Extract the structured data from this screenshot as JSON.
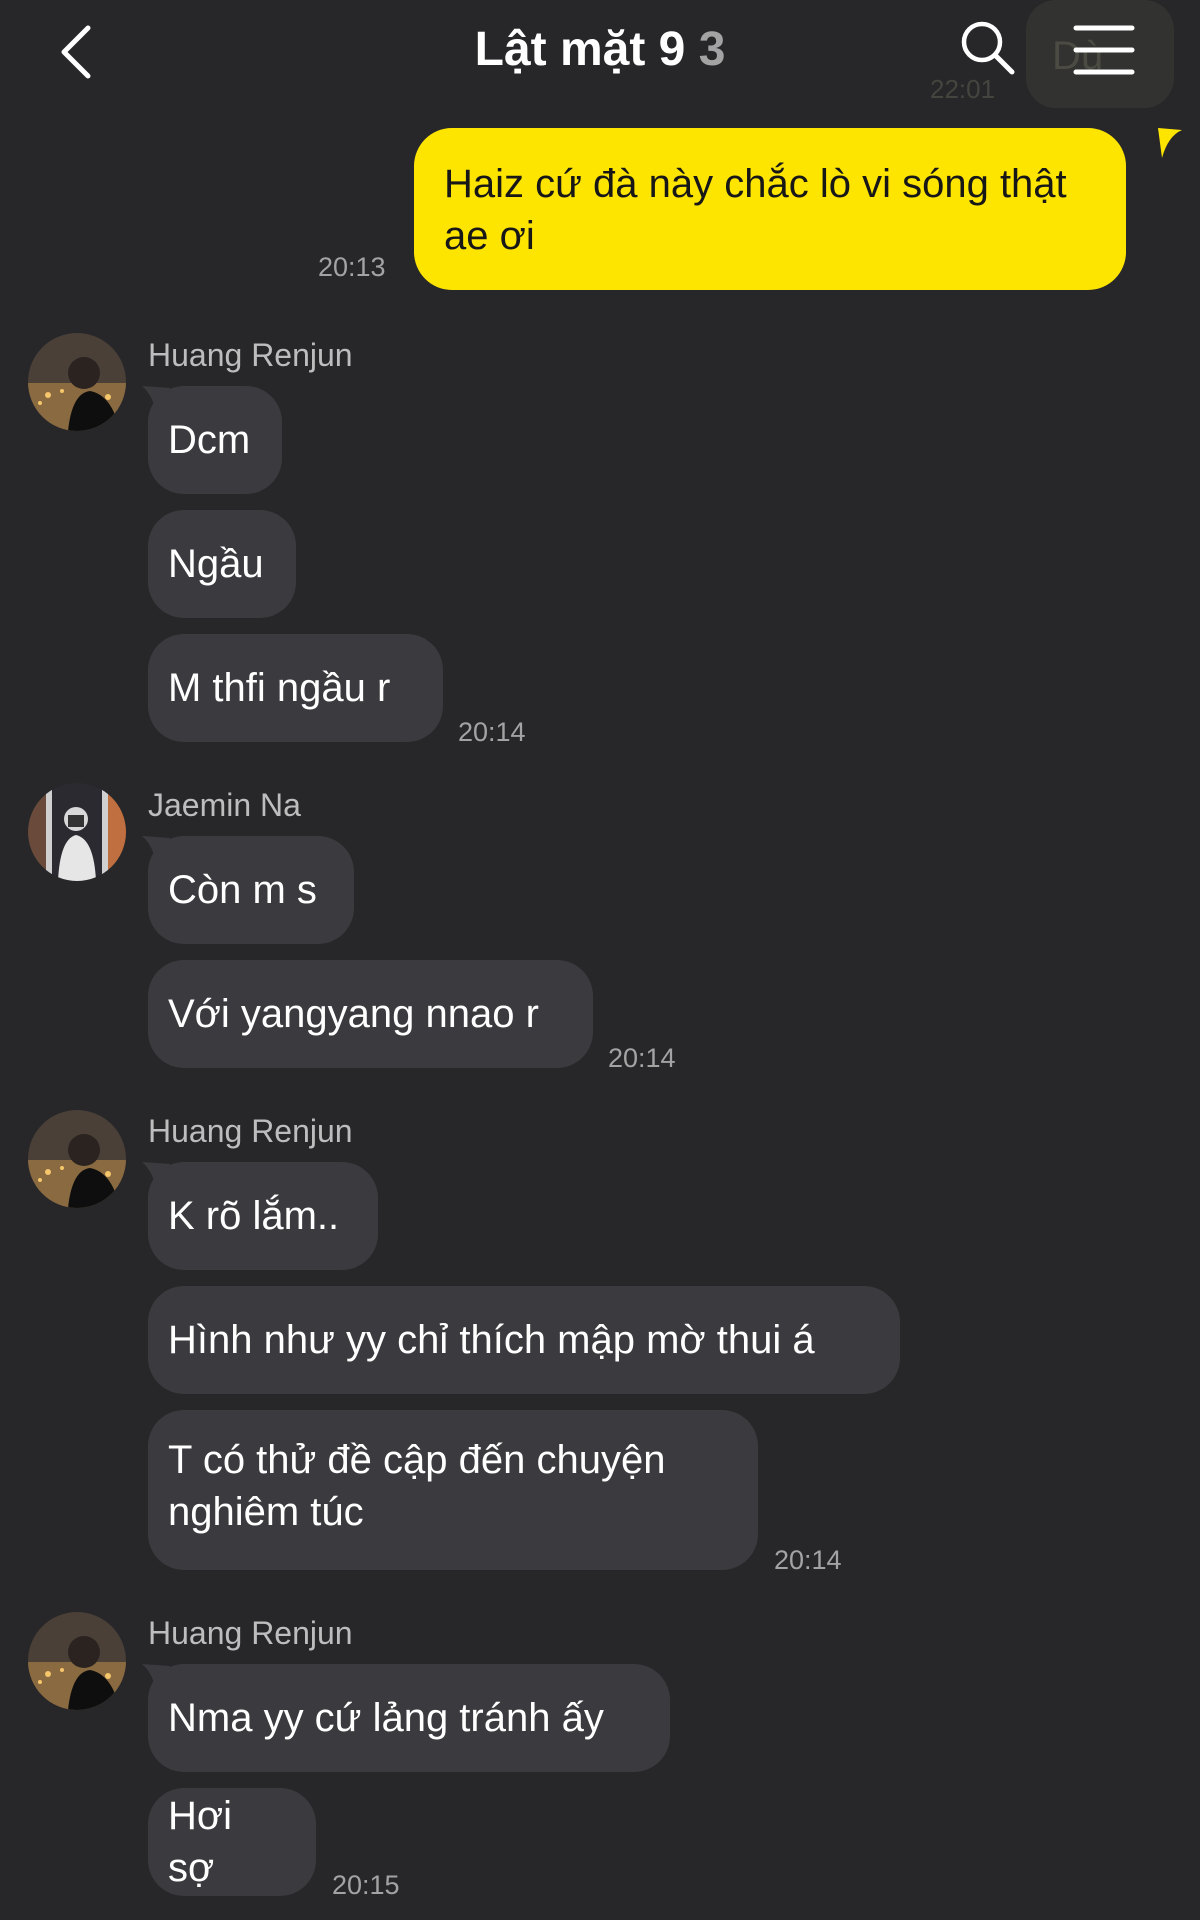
{
  "header": {
    "title": "Lật mặt 9",
    "member_count": "3",
    "ghost_time": "22:01",
    "ghost_word": "Dù"
  },
  "colors": {
    "background": "#27272a",
    "outgoing_bubble": "#fee500",
    "incoming_bubble": "#3b3b3f",
    "timestamp": "#a3a3a3",
    "sender_name": "#bdbdbd"
  },
  "outgoing": [
    {
      "lines": [
        "Haiz cứ đà này chắc lò vi sóng thật",
        "ae ơi"
      ],
      "time": "20:13"
    }
  ],
  "groups": [
    {
      "sender": "Huang Renjun",
      "messages": [
        "Dcm",
        "Ngầu",
        "M thfi ngầu r"
      ],
      "time": "20:14"
    },
    {
      "sender": "Jaemin Na",
      "messages": [
        "Còn m s",
        "Với yangyang nnao r"
      ],
      "time": "20:14"
    },
    {
      "sender": "Huang Renjun",
      "messages": [
        "K rõ lắm..",
        "Hình như yy chỉ thích mập mờ thui á",
        "T có thử đề cập đến chuyện",
        "nghiêm túc"
      ],
      "time": "20:14"
    },
    {
      "sender": "Huang Renjun",
      "messages": [
        "Nma yy cứ lảng tránh ấy",
        "Hơi sợ"
      ],
      "time": "20:15"
    }
  ]
}
